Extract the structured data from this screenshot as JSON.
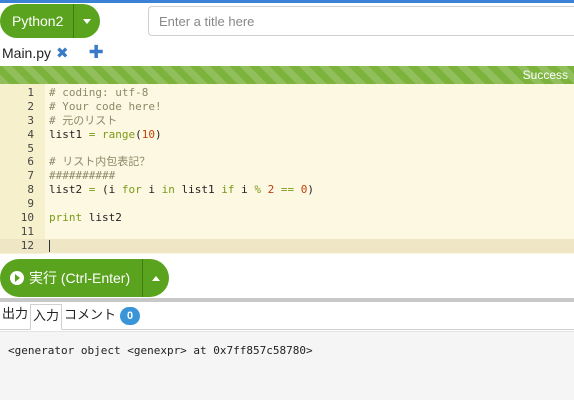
{
  "header": {
    "language_button": "Python2",
    "title_placeholder": "Enter a title here"
  },
  "tabs": {
    "file_name": "Main.py",
    "close_icon": "close-icon",
    "add_icon": "plus-icon"
  },
  "status": {
    "text": "Success",
    "color": "#7cb33d"
  },
  "editor": {
    "lines": [
      {
        "n": "1",
        "tokens": [
          {
            "t": "# coding: utf-8",
            "c": "comment"
          }
        ]
      },
      {
        "n": "2",
        "tokens": [
          {
            "t": "# Your code here!",
            "c": "comment"
          }
        ]
      },
      {
        "n": "3",
        "tokens": [
          {
            "t": "# 元のリスト",
            "c": "comment"
          }
        ]
      },
      {
        "n": "4",
        "tokens": [
          {
            "t": "list1 ",
            "c": ""
          },
          {
            "t": "=",
            "c": "op"
          },
          {
            "t": " ",
            "c": ""
          },
          {
            "t": "range",
            "c": "builtin"
          },
          {
            "t": "(",
            "c": ""
          },
          {
            "t": "10",
            "c": "number"
          },
          {
            "t": ")",
            "c": ""
          }
        ]
      },
      {
        "n": "5",
        "tokens": []
      },
      {
        "n": "6",
        "tokens": [
          {
            "t": "# リスト内包表記？",
            "c": "comment"
          }
        ]
      },
      {
        "n": "7",
        "tokens": [
          {
            "t": "##########",
            "c": "comment"
          }
        ]
      },
      {
        "n": "8",
        "tokens": [
          {
            "t": "list2 ",
            "c": ""
          },
          {
            "t": "=",
            "c": "op"
          },
          {
            "t": " (i ",
            "c": ""
          },
          {
            "t": "for",
            "c": "keyword"
          },
          {
            "t": " i ",
            "c": ""
          },
          {
            "t": "in",
            "c": "keyword"
          },
          {
            "t": " list1 ",
            "c": ""
          },
          {
            "t": "if",
            "c": "keyword"
          },
          {
            "t": " i ",
            "c": ""
          },
          {
            "t": "%",
            "c": "op"
          },
          {
            "t": " ",
            "c": ""
          },
          {
            "t": "2",
            "c": "number"
          },
          {
            "t": " ",
            "c": ""
          },
          {
            "t": "==",
            "c": "op"
          },
          {
            "t": " ",
            "c": ""
          },
          {
            "t": "0",
            "c": "number"
          },
          {
            "t": ")",
            "c": ""
          }
        ]
      },
      {
        "n": "9",
        "tokens": []
      },
      {
        "n": "10",
        "tokens": [
          {
            "t": "print",
            "c": "keyword"
          },
          {
            "t": " list2",
            "c": ""
          }
        ]
      },
      {
        "n": "11",
        "tokens": []
      },
      {
        "n": "12",
        "tokens": [],
        "active": true
      }
    ]
  },
  "run": {
    "label": "実行 (Ctrl-Enter)",
    "icon": "run-circle-arrow-icon"
  },
  "output_tabs": {
    "output": "出力",
    "input": "入力",
    "comment": "コメント",
    "comment_count": "0"
  },
  "output": {
    "text": "<generator object <genexpr> at 0x7ff857c58780>"
  }
}
